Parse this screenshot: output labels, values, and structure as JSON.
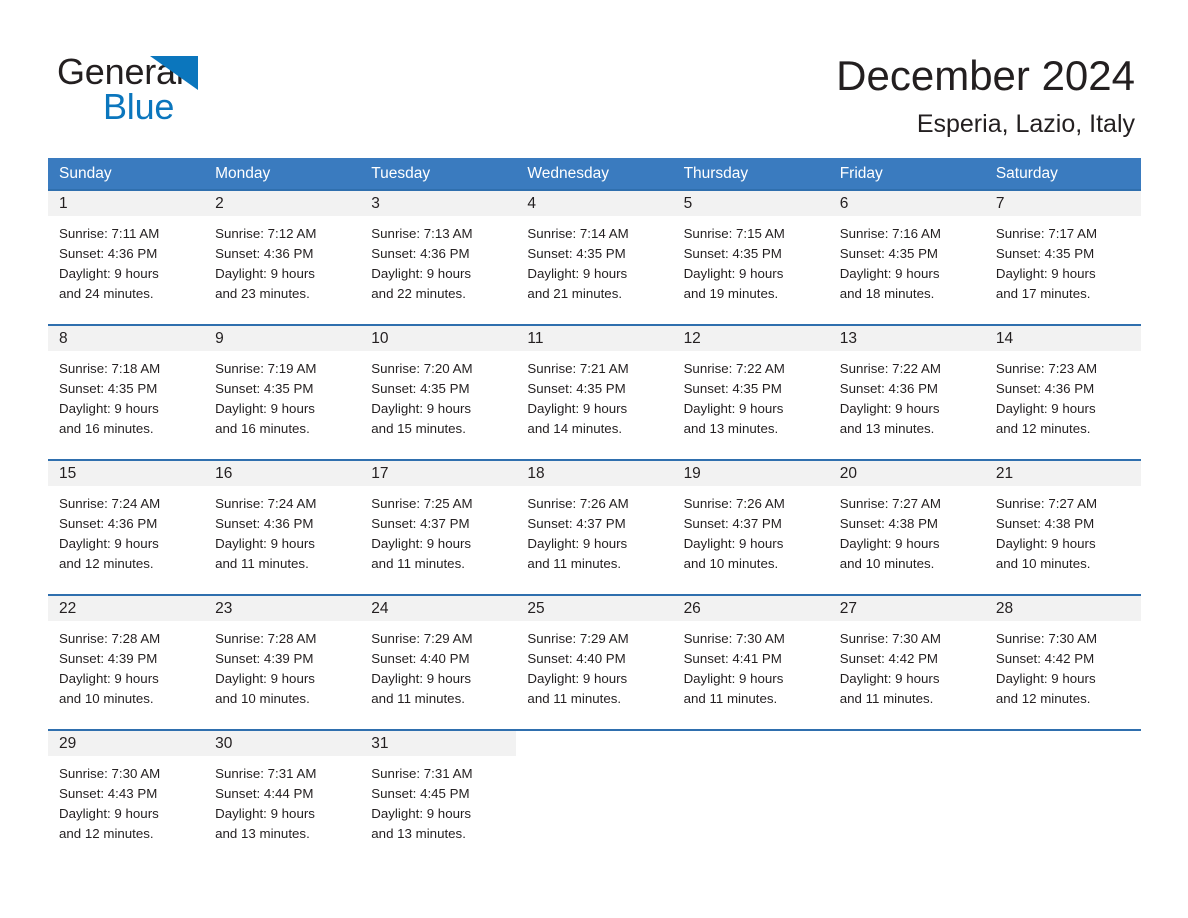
{
  "logo": {
    "word1": "General",
    "word2": "Blue",
    "triangle_color": "#0b76bd",
    "icon": "triangle-icon"
  },
  "header": {
    "title": "December 2024",
    "subtitle": "Esperia, Lazio, Italy"
  },
  "theme": {
    "header_blue": "#3a7bbf",
    "row_border_blue": "#2f6fae",
    "date_strip_gray": "#f2f2f2",
    "text_color": "#231f20"
  },
  "weekdays": [
    "Sunday",
    "Monday",
    "Tuesday",
    "Wednesday",
    "Thursday",
    "Friday",
    "Saturday"
  ],
  "weeks": [
    [
      {
        "day": "1",
        "sunrise": "Sunrise: 7:11 AM",
        "sunset": "Sunset: 4:36 PM",
        "daylight1": "Daylight: 9 hours",
        "daylight2": "and 24 minutes."
      },
      {
        "day": "2",
        "sunrise": "Sunrise: 7:12 AM",
        "sunset": "Sunset: 4:36 PM",
        "daylight1": "Daylight: 9 hours",
        "daylight2": "and 23 minutes."
      },
      {
        "day": "3",
        "sunrise": "Sunrise: 7:13 AM",
        "sunset": "Sunset: 4:36 PM",
        "daylight1": "Daylight: 9 hours",
        "daylight2": "and 22 minutes."
      },
      {
        "day": "4",
        "sunrise": "Sunrise: 7:14 AM",
        "sunset": "Sunset: 4:35 PM",
        "daylight1": "Daylight: 9 hours",
        "daylight2": "and 21 minutes."
      },
      {
        "day": "5",
        "sunrise": "Sunrise: 7:15 AM",
        "sunset": "Sunset: 4:35 PM",
        "daylight1": "Daylight: 9 hours",
        "daylight2": "and 19 minutes."
      },
      {
        "day": "6",
        "sunrise": "Sunrise: 7:16 AM",
        "sunset": "Sunset: 4:35 PM",
        "daylight1": "Daylight: 9 hours",
        "daylight2": "and 18 minutes."
      },
      {
        "day": "7",
        "sunrise": "Sunrise: 7:17 AM",
        "sunset": "Sunset: 4:35 PM",
        "daylight1": "Daylight: 9 hours",
        "daylight2": "and 17 minutes."
      }
    ],
    [
      {
        "day": "8",
        "sunrise": "Sunrise: 7:18 AM",
        "sunset": "Sunset: 4:35 PM",
        "daylight1": "Daylight: 9 hours",
        "daylight2": "and 16 minutes."
      },
      {
        "day": "9",
        "sunrise": "Sunrise: 7:19 AM",
        "sunset": "Sunset: 4:35 PM",
        "daylight1": "Daylight: 9 hours",
        "daylight2": "and 16 minutes."
      },
      {
        "day": "10",
        "sunrise": "Sunrise: 7:20 AM",
        "sunset": "Sunset: 4:35 PM",
        "daylight1": "Daylight: 9 hours",
        "daylight2": "and 15 minutes."
      },
      {
        "day": "11",
        "sunrise": "Sunrise: 7:21 AM",
        "sunset": "Sunset: 4:35 PM",
        "daylight1": "Daylight: 9 hours",
        "daylight2": "and 14 minutes."
      },
      {
        "day": "12",
        "sunrise": "Sunrise: 7:22 AM",
        "sunset": "Sunset: 4:35 PM",
        "daylight1": "Daylight: 9 hours",
        "daylight2": "and 13 minutes."
      },
      {
        "day": "13",
        "sunrise": "Sunrise: 7:22 AM",
        "sunset": "Sunset: 4:36 PM",
        "daylight1": "Daylight: 9 hours",
        "daylight2": "and 13 minutes."
      },
      {
        "day": "14",
        "sunrise": "Sunrise: 7:23 AM",
        "sunset": "Sunset: 4:36 PM",
        "daylight1": "Daylight: 9 hours",
        "daylight2": "and 12 minutes."
      }
    ],
    [
      {
        "day": "15",
        "sunrise": "Sunrise: 7:24 AM",
        "sunset": "Sunset: 4:36 PM",
        "daylight1": "Daylight: 9 hours",
        "daylight2": "and 12 minutes."
      },
      {
        "day": "16",
        "sunrise": "Sunrise: 7:24 AM",
        "sunset": "Sunset: 4:36 PM",
        "daylight1": "Daylight: 9 hours",
        "daylight2": "and 11 minutes."
      },
      {
        "day": "17",
        "sunrise": "Sunrise: 7:25 AM",
        "sunset": "Sunset: 4:37 PM",
        "daylight1": "Daylight: 9 hours",
        "daylight2": "and 11 minutes."
      },
      {
        "day": "18",
        "sunrise": "Sunrise: 7:26 AM",
        "sunset": "Sunset: 4:37 PM",
        "daylight1": "Daylight: 9 hours",
        "daylight2": "and 11 minutes."
      },
      {
        "day": "19",
        "sunrise": "Sunrise: 7:26 AM",
        "sunset": "Sunset: 4:37 PM",
        "daylight1": "Daylight: 9 hours",
        "daylight2": "and 10 minutes."
      },
      {
        "day": "20",
        "sunrise": "Sunrise: 7:27 AM",
        "sunset": "Sunset: 4:38 PM",
        "daylight1": "Daylight: 9 hours",
        "daylight2": "and 10 minutes."
      },
      {
        "day": "21",
        "sunrise": "Sunrise: 7:27 AM",
        "sunset": "Sunset: 4:38 PM",
        "daylight1": "Daylight: 9 hours",
        "daylight2": "and 10 minutes."
      }
    ],
    [
      {
        "day": "22",
        "sunrise": "Sunrise: 7:28 AM",
        "sunset": "Sunset: 4:39 PM",
        "daylight1": "Daylight: 9 hours",
        "daylight2": "and 10 minutes."
      },
      {
        "day": "23",
        "sunrise": "Sunrise: 7:28 AM",
        "sunset": "Sunset: 4:39 PM",
        "daylight1": "Daylight: 9 hours",
        "daylight2": "and 10 minutes."
      },
      {
        "day": "24",
        "sunrise": "Sunrise: 7:29 AM",
        "sunset": "Sunset: 4:40 PM",
        "daylight1": "Daylight: 9 hours",
        "daylight2": "and 11 minutes."
      },
      {
        "day": "25",
        "sunrise": "Sunrise: 7:29 AM",
        "sunset": "Sunset: 4:40 PM",
        "daylight1": "Daylight: 9 hours",
        "daylight2": "and 11 minutes."
      },
      {
        "day": "26",
        "sunrise": "Sunrise: 7:30 AM",
        "sunset": "Sunset: 4:41 PM",
        "daylight1": "Daylight: 9 hours",
        "daylight2": "and 11 minutes."
      },
      {
        "day": "27",
        "sunrise": "Sunrise: 7:30 AM",
        "sunset": "Sunset: 4:42 PM",
        "daylight1": "Daylight: 9 hours",
        "daylight2": "and 11 minutes."
      },
      {
        "day": "28",
        "sunrise": "Sunrise: 7:30 AM",
        "sunset": "Sunset: 4:42 PM",
        "daylight1": "Daylight: 9 hours",
        "daylight2": "and 12 minutes."
      }
    ],
    [
      {
        "day": "29",
        "sunrise": "Sunrise: 7:30 AM",
        "sunset": "Sunset: 4:43 PM",
        "daylight1": "Daylight: 9 hours",
        "daylight2": "and 12 minutes."
      },
      {
        "day": "30",
        "sunrise": "Sunrise: 7:31 AM",
        "sunset": "Sunset: 4:44 PM",
        "daylight1": "Daylight: 9 hours",
        "daylight2": "and 13 minutes."
      },
      {
        "day": "31",
        "sunrise": "Sunrise: 7:31 AM",
        "sunset": "Sunset: 4:45 PM",
        "daylight1": "Daylight: 9 hours",
        "daylight2": "and 13 minutes."
      },
      {
        "day": "",
        "sunrise": "",
        "sunset": "",
        "daylight1": "",
        "daylight2": ""
      },
      {
        "day": "",
        "sunrise": "",
        "sunset": "",
        "daylight1": "",
        "daylight2": ""
      },
      {
        "day": "",
        "sunrise": "",
        "sunset": "",
        "daylight1": "",
        "daylight2": ""
      },
      {
        "day": "",
        "sunrise": "",
        "sunset": "",
        "daylight1": "",
        "daylight2": ""
      }
    ]
  ]
}
